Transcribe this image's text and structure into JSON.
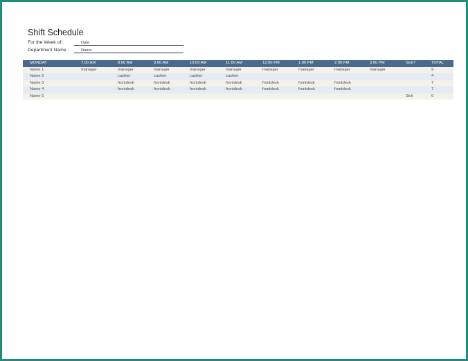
{
  "title": "Shift Schedule",
  "week_label": "For the  Week of:",
  "week_value": "Date",
  "dept_label": "Department Name :",
  "dept_value": "Name",
  "columns": [
    "MONDAY",
    "7:00 AM",
    "8:00 AM",
    "9:00 AM",
    "10:00 AM",
    "11:00 AM",
    "12:00 PM",
    "1:00 PM",
    "2:00 PM",
    "3:00 PM",
    "Sick?",
    "TOTAL"
  ],
  "rows": [
    [
      "Name 1",
      "manager",
      "manager",
      "manager",
      "manager",
      "manager",
      "manager",
      "manager",
      "manager",
      "manager",
      "",
      "9"
    ],
    [
      "Name 2",
      "",
      "cashier",
      "cashier",
      "cashier",
      "cashier",
      "",
      "",
      "",
      "",
      "",
      "4"
    ],
    [
      "Name 3",
      "",
      "frontdesk",
      "frontdesk",
      "frontdesk",
      "frontdesk",
      "frontdesk",
      "frontdesk",
      "frontdesk",
      "",
      "",
      "7"
    ],
    [
      "Name 4",
      "",
      "frontdesk",
      "frontdesk",
      "frontdesk",
      "frontdesk",
      "frontdesk",
      "frontdesk",
      "frontdesk",
      "",
      "",
      "7"
    ],
    [
      "Name 5",
      "",
      "",
      "",
      "",
      "",
      "",
      "",
      "",
      "",
      "Sick",
      "0"
    ]
  ],
  "colors": {
    "header": "#4a6a8c",
    "frame": "#1a8f7d",
    "row_odd": "#f3f1ea",
    "row_even": "#e4ebf2"
  }
}
